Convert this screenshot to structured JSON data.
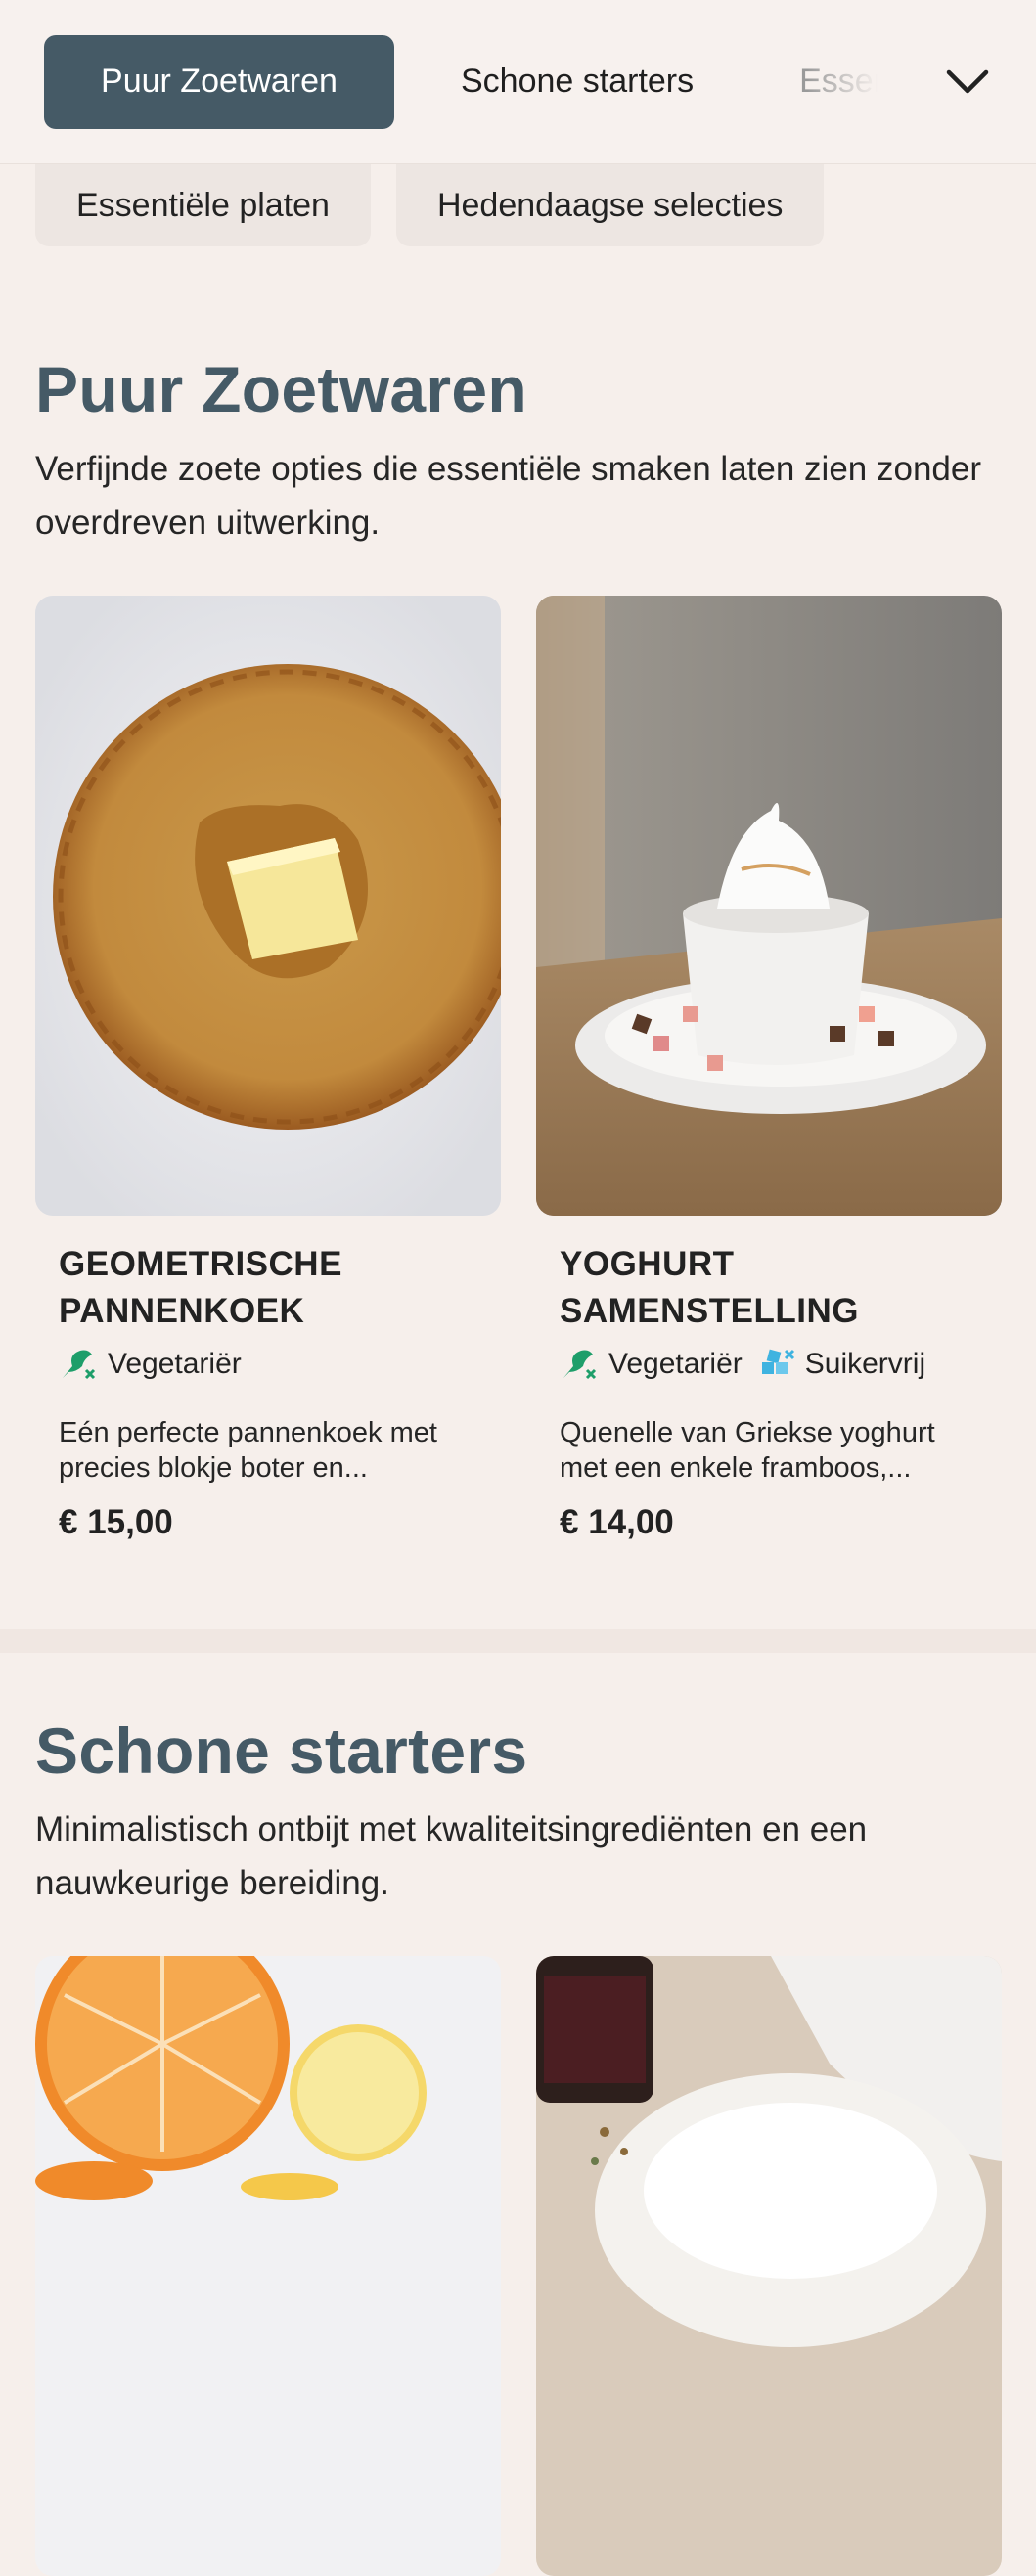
{
  "tabs": [
    {
      "label": "Puur Zoetwaren",
      "active": true
    },
    {
      "label": "Schone starters"
    },
    {
      "label": "Essentiële platen"
    }
  ],
  "chips": [
    "Essentiële platen",
    "Hedendaagse selecties"
  ],
  "sections": [
    {
      "title": "Puur Zoetwaren",
      "description": "Verfijnde zoete opties die essentiële smaken laten zien zonder overdreven uitwerking.",
      "items": [
        {
          "name": "GEOMETRISCHE PANNENKOEK",
          "tags": [
            {
              "label": "Vegetariër",
              "icon": "vegetarian-icon"
            }
          ],
          "description": "Eén perfecte pannenkoek met precies blokje boter en...",
          "price": "€ 15,00"
        },
        {
          "name": "YOGHURT SAMENSTELLING",
          "tags": [
            {
              "label": "Vegetariër",
              "icon": "vegetarian-icon"
            },
            {
              "label": "Suikervrij",
              "icon": "sugar-free-icon"
            }
          ],
          "description": "Quenelle van Griekse yoghurt met een enkele framboos,...",
          "price": "€ 14,00"
        }
      ]
    },
    {
      "title": "Schone starters",
      "description": "Minimalistisch ontbijt met kwaliteitsingrediënten en een nauwkeurige bereiding."
    }
  ],
  "colors": {
    "accent": "#455a66",
    "background": "#f6efeb",
    "vegetarian": "#1e9e6a",
    "sugar_free": "#3fb3e0"
  }
}
